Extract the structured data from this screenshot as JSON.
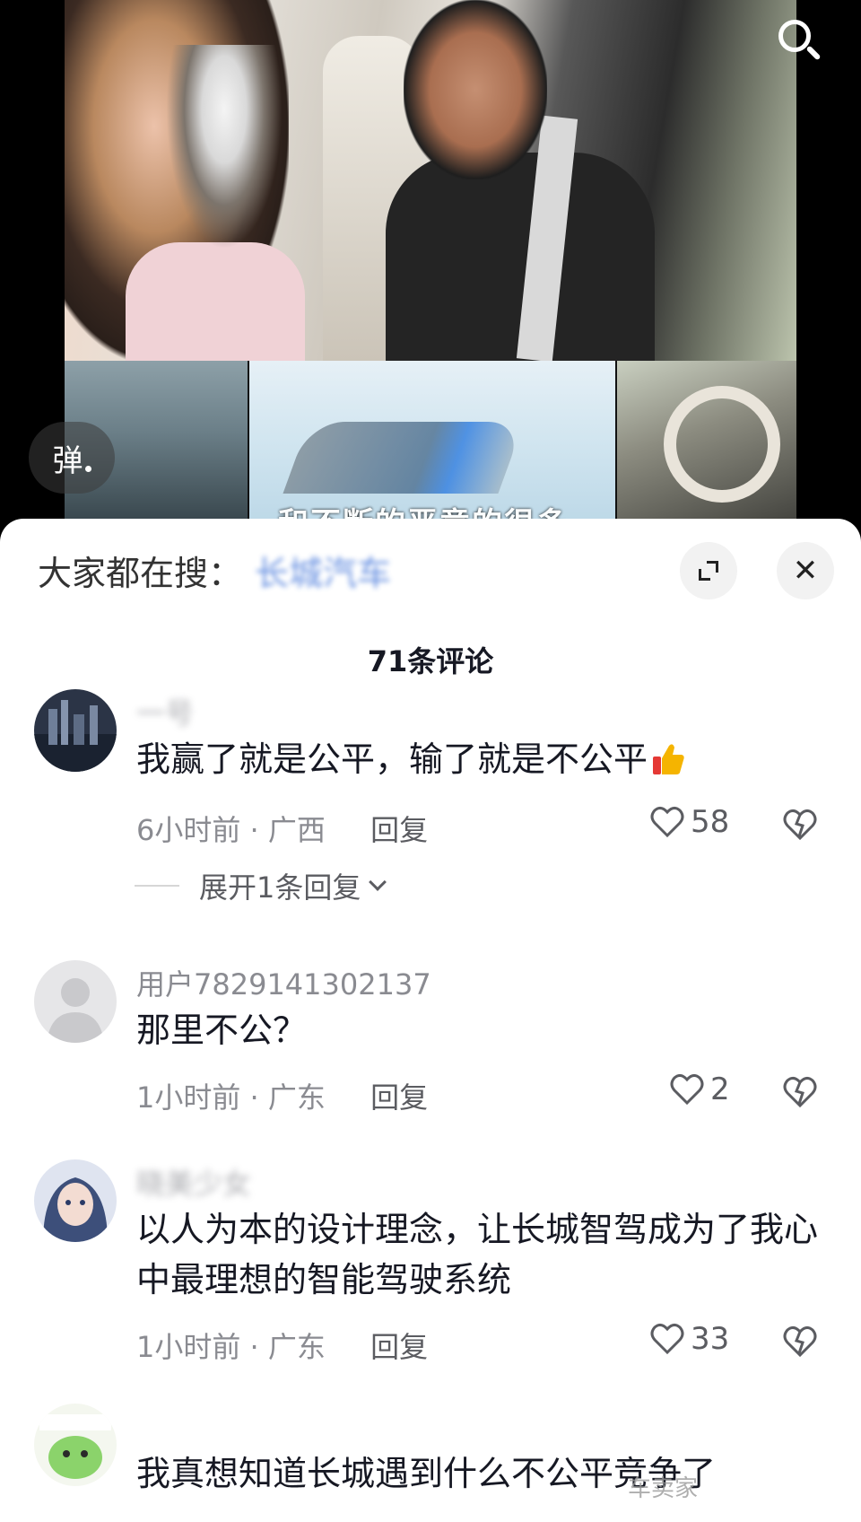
{
  "video": {
    "caption_peek": "和不断的恶意的很多",
    "danmu_label": "弹"
  },
  "sheet": {
    "search_hint_prefix": "大家都在搜：",
    "search_hint_keyword": "长城汽车",
    "comment_count": "71条评论",
    "close_glyph": "✕"
  },
  "comments": [
    {
      "username": "一号",
      "text": "我赢了就是公平，输了就是不公平",
      "time": "6小时前",
      "location": "广西",
      "reply": "回复",
      "likes": "58",
      "expand": "展开1条回复"
    },
    {
      "username": "用户7829141302137",
      "text": "那里不公？",
      "time": "1小时前",
      "location": "广东",
      "reply": "回复",
      "likes": "2"
    },
    {
      "username": "晓美少女",
      "text": "以人为本的设计理念，让长城智驾成为了我心中最理想的智能驾驶系统",
      "time": "1小时前",
      "location": "广东",
      "reply": "回复",
      "likes": "33"
    },
    {
      "username": "",
      "text": "我真想知道长城遇到什么不公平竞争了"
    }
  ],
  "watermark": "车卖家",
  "colors": {
    "text_primary": "#161823",
    "text_secondary": "#8a8b91",
    "accent_link": "#3a6fd8",
    "thumb_emoji": "#f5b400"
  }
}
